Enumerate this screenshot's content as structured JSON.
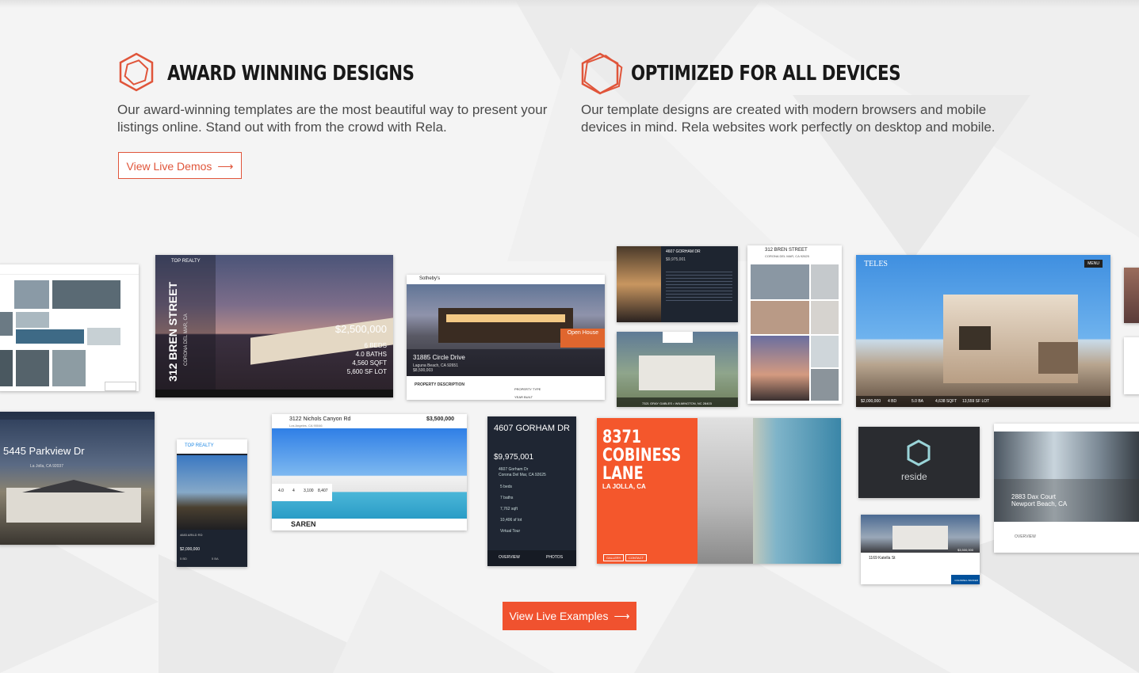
{
  "features": [
    {
      "title": "AWARD WINNING DESIGNS",
      "description": "Our award-winning templates are the most beautiful way to present your listings online. Stand out with from the crowd with Rela.",
      "button_label": "View Live Demos"
    },
    {
      "title": "OPTIMIZED FOR ALL DEVICES",
      "description": "Our template designs are created with modern browsers and mobile devices in mind. Rela websites work perfectly on desktop and mobile."
    }
  ],
  "cta": {
    "label": "View Live Examples"
  },
  "icons": {
    "hexagon": "hexagon-icon",
    "arrow": "arrow-right-icon"
  },
  "colors": {
    "accent": "#f0522f",
    "accent_outline": "#e0553a",
    "heading": "#181818",
    "body": "#4a4a4a"
  },
  "showcase": {
    "top_realty_1": {
      "brand": "TOP REALTY",
      "address": "312 BREN STREET",
      "city": "CORONA DEL MAR, CA",
      "price": "$2,500,000",
      "beds": "6 BEDS",
      "baths": "4.0 BATHS",
      "sqft": "4,560 SQFT",
      "lot": "5,600 SF LOT"
    },
    "sothebys": {
      "brand": "Sotheby's",
      "address": "31885 Circle Drive",
      "city": "Laguna Beach, CA 92651",
      "price": "$8,500,003",
      "badge": "Open House",
      "section": "PROPERTY DESCRIPTION",
      "field1": "PROPERTY TYPE",
      "field2": "YEAR BUILT"
    },
    "gorham_1": {
      "address": "4607 GORHAM DR",
      "price": "$9,975,001"
    },
    "bren_mobile": {
      "address": "312 BREN STREET",
      "city": "CORONA DEL MAR, CA 92625"
    },
    "teles": {
      "brand": "TELES",
      "menu": "MENU",
      "price": "$2,000,000",
      "beds": "4 BD",
      "baths": "5.0 BA",
      "sqft": "4,638 SQFT",
      "lot": "13,559 SF LOT"
    },
    "gray_gables": {
      "address": "7321 GRAY GABLES • WILMINGTON, NC 28403"
    },
    "parkview": {
      "address": "5445 Parkview Dr",
      "city": "La Jolla, CA 92037"
    },
    "top_realty_2": {
      "brand": "TOP REALTY",
      "address": "4683 ARILD RD",
      "price": "$2,000,000",
      "beds": "5 BD",
      "baths": "5 BA",
      "sqft": "4,638 SQFT",
      "lot": "13,559 SF LOT"
    },
    "nichols": {
      "address": "3122 Nichols Canyon Rd",
      "city": "Los Angeles, CA 90046",
      "price": "$3,500,000",
      "brand": "SAREN",
      "stats": [
        "4.0",
        "4",
        "3,100",
        "8,407"
      ]
    },
    "gorham_2": {
      "address": "4607 GORHAM DR",
      "price": "$9,975,001",
      "street": "4607 Gorham Dr",
      "city": "Corona Del Mar, CA 92625",
      "beds": "5 beds",
      "baths": "7 baths",
      "sqft": "7,762 sqft",
      "lot": "10,406 sf lot",
      "tour": "Virtual Tour",
      "tab1": "OVERVIEW",
      "tab2": "PHOTOS"
    },
    "cobiness": {
      "line1": "8371",
      "line2": "COBINESS",
      "line3": "LANE",
      "city": "LA JOLLA, CA",
      "btn1": "GALLERY",
      "btn2": "CONTACT"
    },
    "reside": {
      "brand": "reside"
    },
    "katella": {
      "address": "1169 Katella St",
      "price": "$3,500,000",
      "brand": "COLDWELL BANKER"
    },
    "dax": {
      "address": "2883 Dax Court",
      "city": "Newport Beach, CA",
      "section": "OVERVIEW"
    }
  }
}
